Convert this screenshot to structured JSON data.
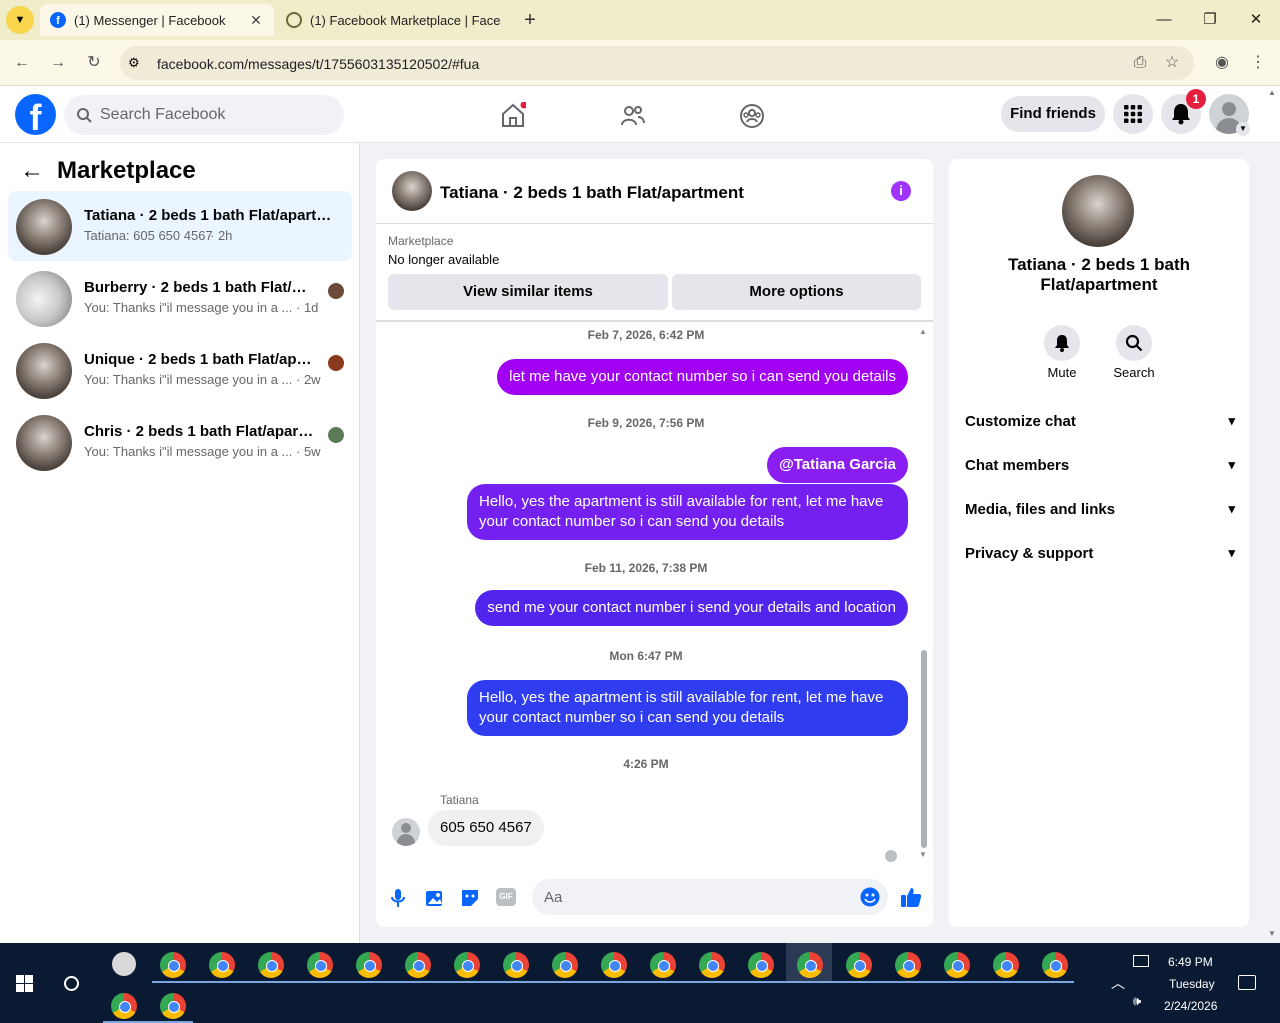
{
  "browser": {
    "tabs": [
      {
        "title": "(1) Messenger | Facebook"
      },
      {
        "title": "(1) Facebook Marketplace | Face"
      }
    ],
    "url": "facebook.com/messages/t/1755603135120502/#fua"
  },
  "header": {
    "search_placeholder": "Search Facebook",
    "find_friends": "Find friends",
    "notification_count": "1"
  },
  "sidebar": {
    "title": "Marketplace",
    "conversations": [
      {
        "name": "Tatiana · 2 beds 1 bath Flat/apartm...",
        "preview": "Tatiana: 605 650 4567",
        "time": "· 2h"
      },
      {
        "name": "Burberry · 2 beds 1 bath Flat/ap...",
        "preview": "You: Thanks i\"il message you in a ...",
        "time": "· 1d"
      },
      {
        "name": "Unique · 2 beds 1 bath Flat/apar...",
        "preview": "You: Thanks i\"il message you in a ...",
        "time": "· 2w"
      },
      {
        "name": "Chris · 2 beds 1 bath Flat/apart...",
        "preview": "You: Thanks i\"il message you in a ...",
        "time": "· 5w"
      }
    ]
  },
  "chat": {
    "title": "Tatiana · 2 beds 1 bath Flat/apartment",
    "listing_source": "Marketplace",
    "listing_status": "No longer available",
    "view_similar": "View similar items",
    "more_options": "More options",
    "timestamps": [
      "Feb 7, 2026, 6:42 PM",
      "Feb 9, 2026, 7:56 PM",
      "Feb 11, 2026, 7:38 PM",
      "Mon 6:47 PM",
      "4:26 PM"
    ],
    "messages": [
      "let me have your contact number so i can send you details",
      "@Tatiana Garcia",
      "Hello, yes the apartment is still available for rent, let me have your contact number so i can send you details",
      "send me your contact number i send your details and location",
      "Hello, yes the apartment is still available for rent, let me have your contact number so i can send you details"
    ],
    "incoming_sender": "Tatiana",
    "incoming_text": "605 650 4567",
    "composer_placeholder": "Aa"
  },
  "details": {
    "name": "Tatiana · 2 beds 1 bath Flat/apartment",
    "mute": "Mute",
    "search": "Search",
    "sections": [
      "Customize chat",
      "Chat members",
      "Media, files and links",
      "Privacy & support"
    ]
  },
  "taskbar": {
    "time": "6:49 PM",
    "day": "Tuesday",
    "date": "2/24/2026"
  }
}
